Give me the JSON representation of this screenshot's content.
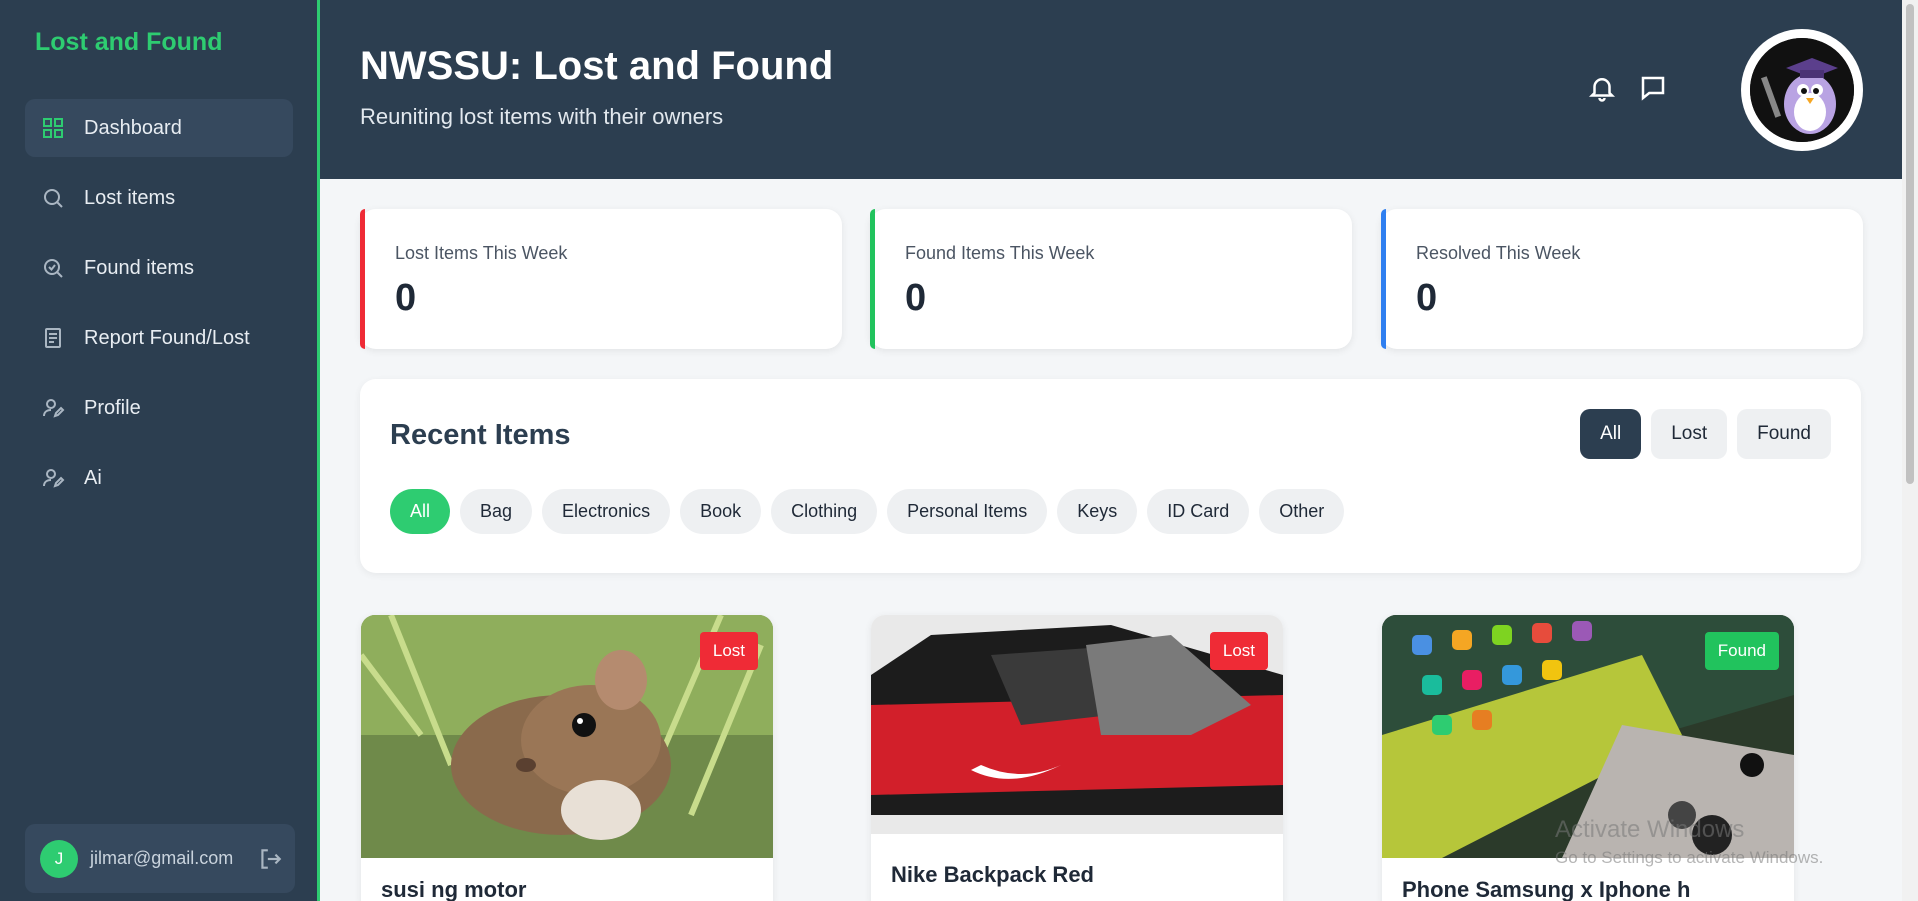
{
  "sidebar": {
    "brand": "Lost and Found",
    "items": [
      {
        "label": "Dashboard",
        "icon": "grid-icon"
      },
      {
        "label": "Lost items",
        "icon": "search-icon"
      },
      {
        "label": "Found items",
        "icon": "search-check-icon"
      },
      {
        "label": "Report Found/Lost",
        "icon": "document-icon"
      },
      {
        "label": "Profile",
        "icon": "user-edit-icon"
      },
      {
        "label": "Ai",
        "icon": "user-edit-icon"
      }
    ],
    "user": {
      "initial": "J",
      "email": "jilmar@gmail.com"
    }
  },
  "header": {
    "title": "NWSSU: Lost and Found",
    "subtitle": "Reuniting lost items with their owners"
  },
  "stats": [
    {
      "label": "Lost Items This Week",
      "value": "0",
      "color": "#ef2b36"
    },
    {
      "label": "Found Items This Week",
      "value": "0",
      "color": "#21c35d"
    },
    {
      "label": "Resolved This Week",
      "value": "0",
      "color": "#2f7ff0"
    }
  ],
  "recent": {
    "title": "Recent Items",
    "tabs": [
      "All",
      "Lost",
      "Found"
    ],
    "categories": [
      "All",
      "Bag",
      "Electronics",
      "Book",
      "Clothing",
      "Personal Items",
      "Keys",
      "ID Card",
      "Other"
    ]
  },
  "items": [
    {
      "name": "susi ng motor",
      "status": "Lost"
    },
    {
      "name": "Nike Backpack Red",
      "status": "Lost"
    },
    {
      "name": "Phone Samsung x Iphone h",
      "status": "Found"
    }
  ],
  "watermark": {
    "line1": "Activate Windows",
    "line2": "Go to Settings to activate Windows."
  },
  "colors": {
    "sidebar": "#2c3e50",
    "accent": "#2ecc71",
    "lost": "#ef2b36",
    "found": "#21c35d",
    "resolved": "#2f7ff0"
  }
}
